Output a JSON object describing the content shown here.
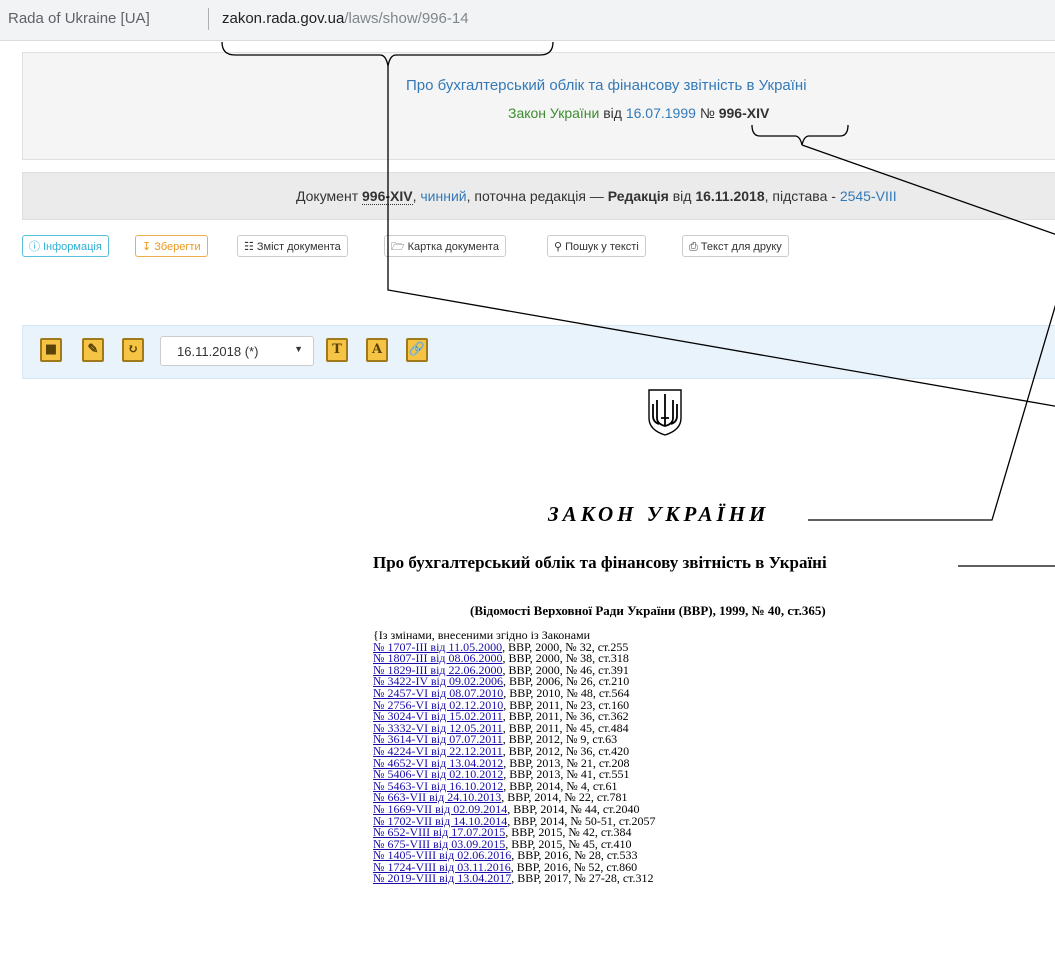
{
  "address_bar": {
    "site_name": "Rada of Ukraine [UA]",
    "url_domain": "zakon.rada.gov.ua",
    "url_path": "/laws/show/996-14"
  },
  "header": {
    "title": "Про бухгалтерський облік та фінансову звітність в Україні",
    "law_type": "Закон України",
    "from_word": "від",
    "date": "16.07.1999",
    "number_prefix": "№",
    "number": "996-XIV"
  },
  "status": {
    "doc_word": "Документ",
    "doc_number": "996-XIV",
    "state": "чинний",
    "current_edition": ", поточна редакція —",
    "edition_word": "Редакція",
    "from_word": "від",
    "edition_date": "16.11.2018",
    "basis_word": ", підстава -",
    "basis_link": "2545-VIII"
  },
  "buttons": [
    {
      "label": "Інформація",
      "icon": "info-icon"
    },
    {
      "label": "Зберегти",
      "icon": "download-icon"
    },
    {
      "label": "Зміст документа",
      "icon": "sitemap-icon"
    },
    {
      "label": "Картка документа",
      "icon": "folder-icon"
    },
    {
      "label": "Пошук у тексті",
      "icon": "search-icon"
    },
    {
      "label": "Текст для друку",
      "icon": "print-icon"
    }
  ],
  "toolbar": {
    "edition_select": "16.11.2018 (*)",
    "icon_t": "T",
    "icon_a": "A"
  },
  "document": {
    "heading": "ЗАКОН УКРАЇНИ",
    "title": "Про бухгалтерський облік та фінансову звітність в Україні",
    "source": "(Відомості Верховної Ради України (ВВР), 1999, № 40, ст.365)",
    "amend_intro": "{Із змінами, внесеними згідно із Законами",
    "amendments": [
      {
        "link": "№ 1707-III від 11.05.2000",
        "ref": ", ВВР, 2000, № 32, ст.255"
      },
      {
        "link": "№ 1807-III від 08.06.2000",
        "ref": ", ВВР, 2000, № 38, ст.318"
      },
      {
        "link": "№ 1829-III від 22.06.2000",
        "ref": ", ВВР, 2000, № 46, ст.391"
      },
      {
        "link": "№ 3422-IV від 09.02.2006",
        "ref": ", ВВР, 2006, № 26, ст.210"
      },
      {
        "link": "№ 2457-VI від 08.07.2010",
        "ref": ", ВВР, 2010, № 48, ст.564"
      },
      {
        "link": "№ 2756-VI від 02.12.2010",
        "ref": ", ВВР, 2011, № 23, ст.160"
      },
      {
        "link": "№ 3024-VI від 15.02.2011",
        "ref": ", ВВР, 2011, № 36, ст.362"
      },
      {
        "link": "№ 3332-VI від 12.05.2011",
        "ref": ", ВВР, 2011, № 45, ст.484"
      },
      {
        "link": "№ 3614-VI від 07.07.2011",
        "ref": ", ВВР, 2012, № 9, ст.63"
      },
      {
        "link": "№ 4224-VI від 22.12.2011",
        "ref": ", ВВР, 2012, № 36, ст.420"
      },
      {
        "link": "№ 4652-VI від 13.04.2012",
        "ref": ", ВВР, 2013, № 21, ст.208"
      },
      {
        "link": "№ 5406-VI від 02.10.2012",
        "ref": ", ВВР, 2013, № 41, ст.551"
      },
      {
        "link": "№ 5463-VI від 16.10.2012",
        "ref": ", ВВР, 2014, № 4, ст.61"
      },
      {
        "link": "№ 663-VII від 24.10.2013",
        "ref": ", ВВР, 2014, № 22, ст.781"
      },
      {
        "link": "№ 1669-VII від 02.09.2014",
        "ref": ", ВВР, 2014, № 44, ст.2040"
      },
      {
        "link": "№ 1702-VII від 14.10.2014",
        "ref": ", ВВР, 2014, № 50-51, ст.2057"
      },
      {
        "link": "№ 652-VIII від 17.07.2015",
        "ref": ", ВВР, 2015, № 42, ст.384"
      },
      {
        "link": "№ 675-VIII від 03.09.2015",
        "ref": ", ВВР, 2015, № 45, ст.410"
      },
      {
        "link": "№ 1405-VIII від 02.06.2016",
        "ref": ", ВВР, 2016, № 28, ст.533"
      },
      {
        "link": "№ 1724-VIII від 03.11.2016",
        "ref": ", ВВР, 2016, № 52, ст.860"
      },
      {
        "link": "№ 2019-VIII від 13.04.2017",
        "ref": ", ВВР, 2017, № 27-28, ст.312"
      }
    ]
  },
  "colors": {
    "link": "#3479b7",
    "accent_green": "#3c8d2f",
    "toolbar_bg": "#e9f3fb"
  }
}
